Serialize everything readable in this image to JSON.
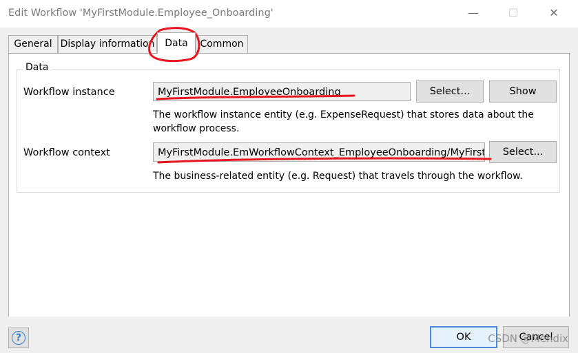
{
  "window": {
    "title": "Edit Workflow 'MyFirstModule.Employee_Onboarding'",
    "minimize_label": "—",
    "maximize_label": "☐",
    "close_label": "✕"
  },
  "tabs": [
    {
      "label": "General",
      "active": false
    },
    {
      "label": "Display information",
      "active": false
    },
    {
      "label": "Data",
      "active": true
    },
    {
      "label": "Common",
      "active": false
    }
  ],
  "data_group": {
    "label": "Data",
    "workflow_instance": {
      "label": "Workflow instance",
      "value": "MyFirstModule.EmployeeOnboarding",
      "select_label": "Select...",
      "show_label": "Show",
      "help": "The workflow instance entity (e.g. ExpenseRequest) that stores data about the workflow process."
    },
    "workflow_context": {
      "label": "Workflow context",
      "value": "MyFirstModule.EmWorkflowContext_EmployeeOnboarding/MyFirstModule",
      "select_label": "Select...",
      "help": "The business-related entity (e.g. Request) that travels through the workflow."
    }
  },
  "footer": {
    "help_icon": "?",
    "ok_label": "OK",
    "cancel_label": "Cancel"
  },
  "watermark": "CSDN @Mendix",
  "colors": {
    "annotation": "#e8141e",
    "accent": "#4a8ad6"
  }
}
